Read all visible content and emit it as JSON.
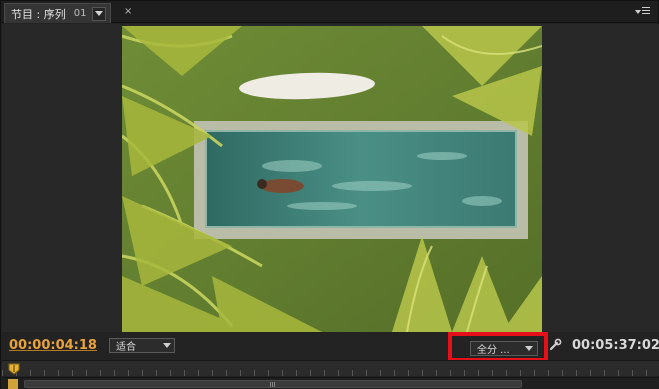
{
  "tab": {
    "label": "节目 : 序列",
    "sequence_number": "01",
    "close_glyph": "×"
  },
  "viewer": {
    "image": "aerial-pool-palms"
  },
  "controls": {
    "current_timecode": "00:00:04:18",
    "fit_label": "适合",
    "quality_label": "全分 ...",
    "duration_timecode": "00:05:37:02"
  },
  "icons": {
    "tab_menu": "chevron-down-icon",
    "panel_menu": "panel-menu-icon",
    "wrench": "wrench-icon",
    "playhead": "playhead-icon"
  },
  "colors": {
    "timecode_current": "#e8a33a",
    "highlight_box": "#e6101a"
  }
}
